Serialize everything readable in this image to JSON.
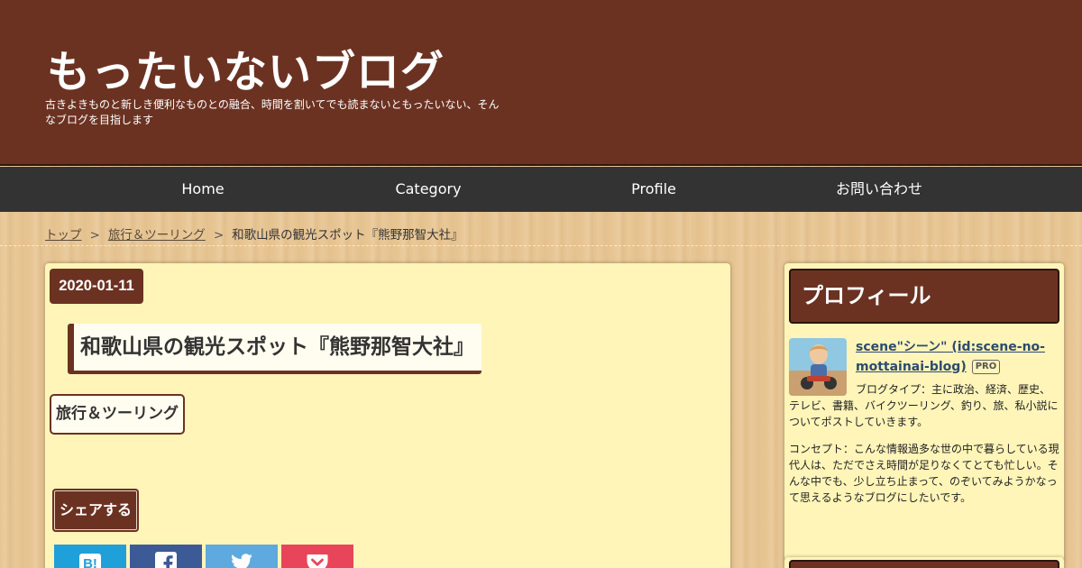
{
  "header": {
    "blog_title": "もったいないブログ",
    "blog_description": "古きよきものと新しき便利なものとの融合、時間を割いてでも読まないともったいない、そんなブログを目指します"
  },
  "nav": {
    "items": [
      {
        "label": "Home"
      },
      {
        "label": "Category"
      },
      {
        "label": "Profile"
      },
      {
        "label": "お問い合わせ"
      }
    ]
  },
  "breadcrumb": {
    "items": [
      "トップ",
      "旅行＆ツーリング",
      "和歌山県の観光スポット『熊野那智大社』"
    ],
    "separator": ">"
  },
  "entry": {
    "date": "2020-01-11",
    "title": "和歌山県の観光スポット『熊野那智大社』",
    "category": "旅行＆ツーリング",
    "share_label": "シェアする",
    "share_buttons": [
      {
        "icon": "hatena-bookmark-icon",
        "color": "#20a0d8"
      },
      {
        "icon": "facebook-icon",
        "color": "#3b5a96"
      },
      {
        "icon": "twitter-icon",
        "color": "#5ea9dd"
      },
      {
        "icon": "pocket-icon",
        "color": "#e8455a"
      }
    ]
  },
  "sidebar": {
    "profile_title": "プロフィール",
    "profile_name": "scene\"シーン\" (id:scene-no-mottainai-blog)",
    "pro_badge": "PRO",
    "profile_description": "ブログタイプ：主に政治、経済、歴史、テレビ、書籍、バイクツーリング、釣り、旅、私小説についてポストしていきます。",
    "profile_concept": "コンセプト：こんな情報過多な世の中で暮らしている現代人は、ただでさえ時間が足りなくてとても忙しい。そんな中でも、少し立ち止まって、のぞいてみようかなって思えるようなブログにしたいです。"
  },
  "colors": {
    "header_bg": "#6b3222",
    "nav_bg": "#333333",
    "card_bg": "#fff5b9",
    "accent": "#6b3222"
  }
}
